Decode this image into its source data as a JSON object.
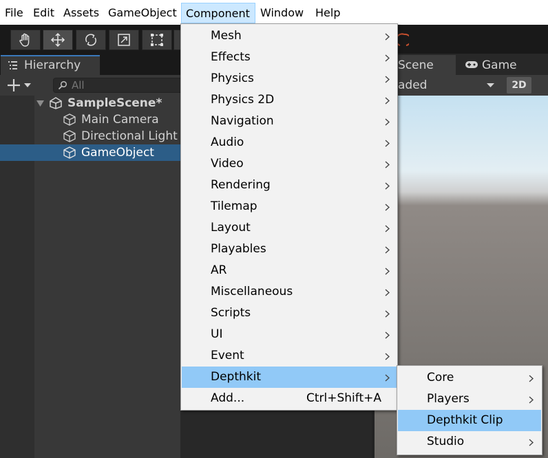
{
  "menubar": {
    "items": [
      "File",
      "Edit",
      "Assets",
      "GameObject",
      "Component",
      "Window",
      "Help"
    ],
    "active": "Component"
  },
  "toolbar": {
    "tools": [
      "hand-tool-icon",
      "move-tool-icon",
      "rotate-tool-icon",
      "scale-tool-icon",
      "rect-tool-icon"
    ],
    "active_tool": "move-tool-icon"
  },
  "hierarchy": {
    "tab_label": "Hierarchy",
    "search_placeholder": "All",
    "scene_name": "SampleScene*",
    "objects": [
      "Main Camera",
      "Directional Light",
      "GameObject"
    ],
    "selected": "GameObject"
  },
  "scene_view": {
    "scene_tab": "Scene",
    "game_tab": "Game",
    "shading_mode": "aded",
    "mode_2d": "2D"
  },
  "component_menu": {
    "items": [
      {
        "label": "Mesh",
        "submenu": true
      },
      {
        "label": "Effects",
        "submenu": true
      },
      {
        "label": "Physics",
        "submenu": true
      },
      {
        "label": "Physics 2D",
        "submenu": true
      },
      {
        "label": "Navigation",
        "submenu": true
      },
      {
        "label": "Audio",
        "submenu": true
      },
      {
        "label": "Video",
        "submenu": true
      },
      {
        "label": "Rendering",
        "submenu": true
      },
      {
        "label": "Tilemap",
        "submenu": true
      },
      {
        "label": "Layout",
        "submenu": true
      },
      {
        "label": "Playables",
        "submenu": true
      },
      {
        "label": "AR",
        "submenu": true
      },
      {
        "label": "Miscellaneous",
        "submenu": true
      },
      {
        "label": "Scripts",
        "submenu": true
      },
      {
        "label": "UI",
        "submenu": true
      },
      {
        "label": "Event",
        "submenu": true
      },
      {
        "label": "Depthkit",
        "submenu": true,
        "highlighted": true
      },
      {
        "label": "Add...",
        "shortcut": "Ctrl+Shift+A"
      }
    ]
  },
  "depthkit_submenu": {
    "items": [
      {
        "label": "Core",
        "submenu": true
      },
      {
        "label": "Players",
        "submenu": true
      },
      {
        "label": "Depthkit Clip",
        "highlighted": true
      },
      {
        "label": "Studio",
        "submenu": true
      }
    ]
  },
  "colors": {
    "menu_highlight": "#91c9f7",
    "selection_blue": "#2c5d87",
    "panel_bg": "#383838"
  }
}
